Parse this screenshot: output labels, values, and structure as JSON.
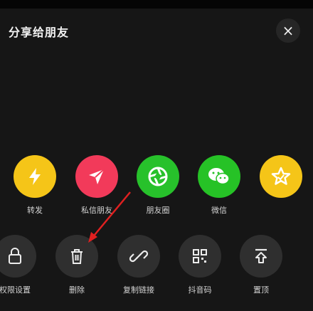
{
  "header": {
    "title": "分享给朋友",
    "close_label": "×"
  },
  "share_row": [
    {
      "label": "转发",
      "icon": "lightning-icon",
      "color": "#f5c518"
    },
    {
      "label": "私信朋友",
      "icon": "paper-plane-icon",
      "color": "#f23a5a"
    },
    {
      "label": "朋友圈",
      "icon": "camera-aperture-icon",
      "color": "#27c12b"
    },
    {
      "label": "微信",
      "icon": "wechat-icon",
      "color": "#26c226"
    },
    {
      "label": "",
      "icon": "star-badge-icon",
      "color": "#f5c518"
    }
  ],
  "action_row": [
    {
      "label": "权限设置",
      "icon": "lock-icon"
    },
    {
      "label": "删除",
      "icon": "trash-icon"
    },
    {
      "label": "复制链接",
      "icon": "link-icon"
    },
    {
      "label": "抖音码",
      "icon": "qr-code-icon"
    },
    {
      "label": "置顶",
      "icon": "pin-top-icon"
    }
  ],
  "colors": {
    "background": "#161616",
    "action_circle": "#2f2f2f",
    "annotation_arrow": "#e02020"
  }
}
